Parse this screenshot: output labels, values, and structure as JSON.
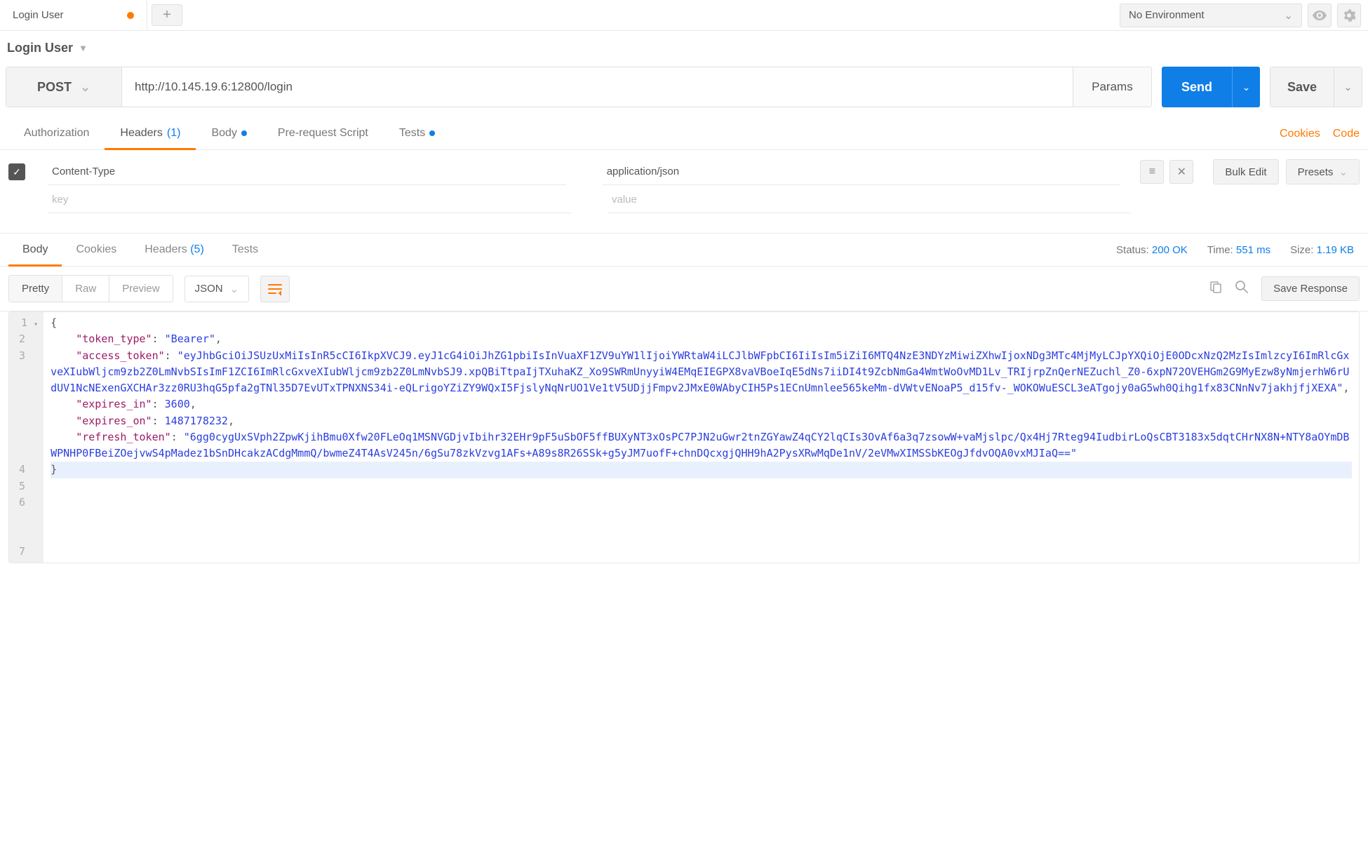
{
  "tab": {
    "label": "Login User"
  },
  "environment": {
    "selected": "No Environment"
  },
  "breadcrumb": {
    "title": "Login User"
  },
  "request": {
    "method": "POST",
    "url": "http://10.145.19.6:12800/login",
    "params_label": "Params",
    "send_label": "Send",
    "save_label": "Save"
  },
  "request_tabs": {
    "authorization": "Authorization",
    "headers": "Headers",
    "headers_count": "(1)",
    "body": "Body",
    "pre_request": "Pre-request Script",
    "tests": "Tests"
  },
  "links": {
    "cookies": "Cookies",
    "code": "Code"
  },
  "header_row": {
    "key": "Content-Type",
    "value": "application/json",
    "key_placeholder": "key",
    "value_placeholder": "value",
    "bulk_edit": "Bulk Edit",
    "presets": "Presets"
  },
  "response_tabs": {
    "body": "Body",
    "cookies": "Cookies",
    "headers": "Headers",
    "headers_count": "(5)",
    "tests": "Tests"
  },
  "status": {
    "status_label": "Status:",
    "status_value": "200 OK",
    "time_label": "Time:",
    "time_value": "551 ms",
    "size_label": "Size:",
    "size_value": "1.19 KB"
  },
  "format": {
    "pretty": "Pretty",
    "raw": "Raw",
    "preview": "Preview",
    "type": "JSON",
    "save_response": "Save Response"
  },
  "response_body": {
    "token_type_key": "\"token_type\"",
    "token_type_val": "\"Bearer\"",
    "access_token_key": "\"access_token\"",
    "access_token_val": "\"eyJhbGciOiJSUzUxMiIsInR5cCI6IkpXVCJ9.eyJ1cG4iOiJhZG1pbiIsInVuaXF1ZV9uYW1lIjoiYWRtaW4iLCJlbWFpbCI6IiIsIm5iZiI6MTQ4NzE3NDYzMiwiZXhwIjoxNDg3MTc4MjMyLCJpYXQiOjE0ODcxNzQ2MzIsImlzcyI6ImRlcGxveXIubWljcm9zb2Z0LmNvbSIsImF1ZCI6ImRlcGxveXIubWljcm9zb2Z0LmNvbSJ9.xpQBiTtpaIjTXuhaKZ_Xo9SWRmUnyyiW4EMqEIEGPX8vaVBoeIqE5dNs7iiDI4t9ZcbNmGa4WmtWoOvMD1Lv_TRIjrpZnQerNEZuchl_Z0-6xpN72OVEHGm2G9MyEzw8yNmjerhW6rUdUV1NcNExenGXCHAr3zz0RU3hqG5pfa2gTNl35D7EvUTxTPNXNS34i-eQLrigoYZiZY9WQxI5FjslyNqNrUO1Ve1tV5UDjjFmpv2JMxE0WAbyCIH5Ps1ECnUmnlee565keMm-dVWtvENoaP5_d15fv-_WOKOWuESCL3eATgojy0aG5wh0Qihg1fx83CNnNv7jakhjfjXEXA\"",
    "expires_in_key": "\"expires_in\"",
    "expires_in_val": "3600",
    "expires_on_key": "\"expires_on\"",
    "expires_on_val": "1487178232",
    "refresh_token_key": "\"refresh_token\"",
    "refresh_token_val": "\"6gg0cygUxSVph2ZpwKjihBmu0Xfw20FLeOq1MSNVGDjvIbihr32EHr9pF5uSbOF5ffBUXyNT3xOsPC7PJN2uGwr2tnZGYawZ4qCY2lqCIs3OvAf6a3q7zsowW+vaMjslpc/Qx4Hj7Rteg94IudbirLoQsCBT3183x5dqtCHrNX8N+NTY8aOYmDBWPNHP0FBeiZOejvwS4pMadez1bSnDHcakzACdgMmmQ/bwmeZ4T4AsV245n/6gSu78zkVzvg1AFs+A89s8R26SSk+g5yJM7uofF+chnDQcxgjQHH9hA2PysXRwMqDe1nV/2eVMwXIMSSbKEOgJfdvOQA0vxMJIaQ==\""
  }
}
